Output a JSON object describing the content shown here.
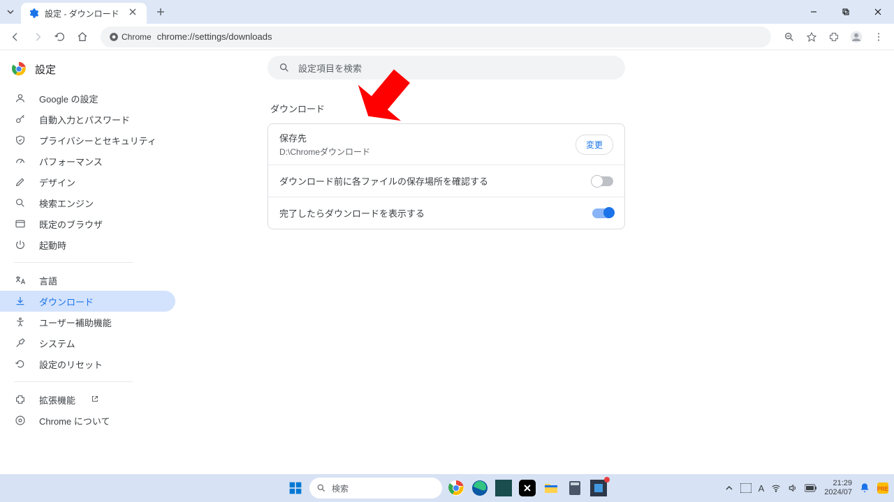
{
  "tab": {
    "title": "設定 - ダウンロード"
  },
  "omnibox": {
    "chip": "Chrome",
    "url": "chrome://settings/downloads"
  },
  "sidebar": {
    "title": "設定",
    "items": [
      {
        "label": "Google の設定"
      },
      {
        "label": "自動入力とパスワード"
      },
      {
        "label": "プライバシーとセキュリティ"
      },
      {
        "label": "パフォーマンス"
      },
      {
        "label": "デザイン"
      },
      {
        "label": "検索エンジン"
      },
      {
        "label": "既定のブラウザ"
      },
      {
        "label": "起動時"
      }
    ],
    "items2": [
      {
        "label": "言語"
      },
      {
        "label": "ダウンロード"
      },
      {
        "label": "ユーザー補助機能"
      },
      {
        "label": "システム"
      },
      {
        "label": "設定のリセット"
      }
    ],
    "items3": [
      {
        "label": "拡張機能"
      },
      {
        "label": "Chrome について"
      }
    ]
  },
  "main": {
    "search_placeholder": "設定項目を検索",
    "section": "ダウンロード",
    "location_label": "保存先",
    "location_path": "D:\\Chromeダウンロード",
    "change_btn": "変更",
    "ask_label": "ダウンロード前に各ファイルの保存場所を確認する",
    "show_label": "完了したらダウンロードを表示する"
  },
  "taskbar": {
    "search": "検索",
    "time": "21:29",
    "date": "2024/07"
  }
}
